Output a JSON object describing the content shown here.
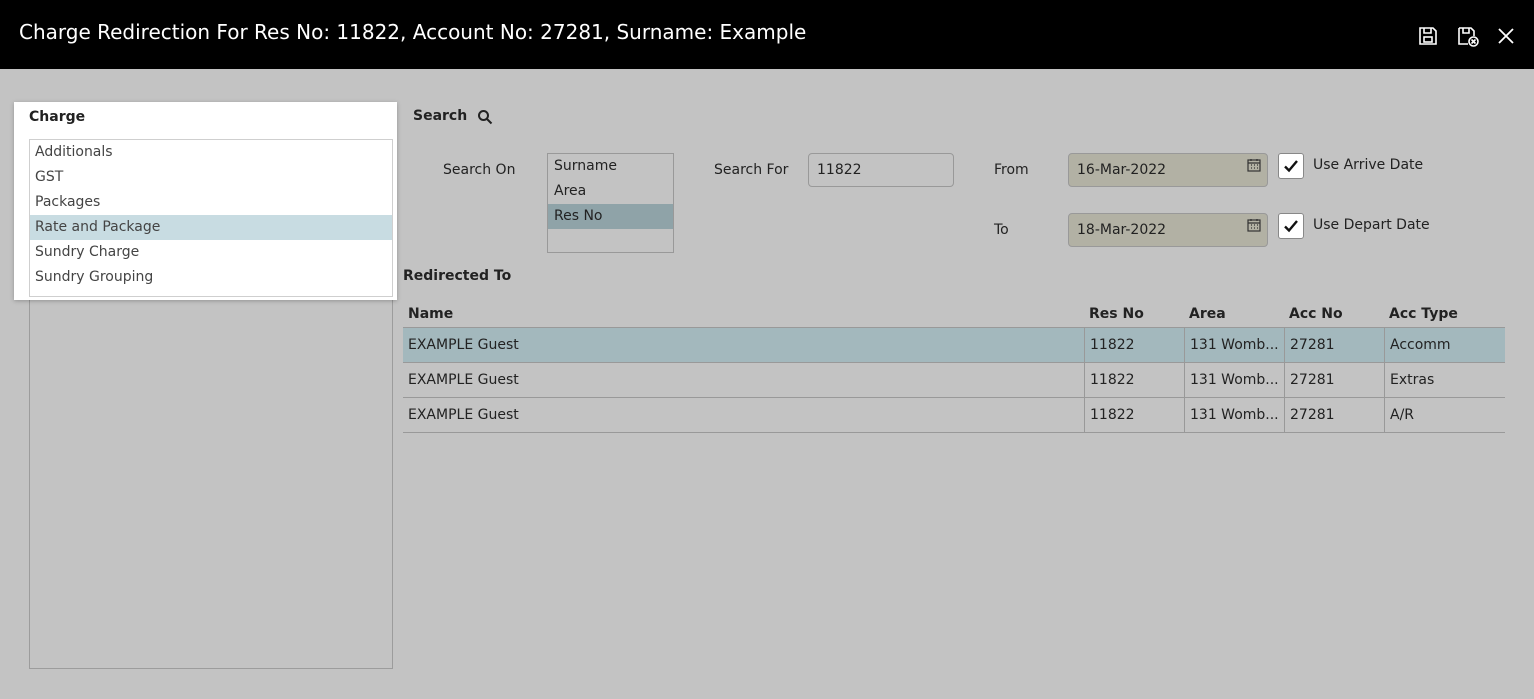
{
  "window": {
    "title": "Charge Redirection For Res No: 11822, Account No: 27281, Surname: Example",
    "buttons": [
      "save-icon",
      "save-and-close-icon",
      "close-icon"
    ]
  },
  "charge": {
    "header": "Charge",
    "items": [
      {
        "label": "Additionals",
        "selected": false
      },
      {
        "label": "GST",
        "selected": false
      },
      {
        "label": "Packages",
        "selected": false
      },
      {
        "label": "Rate and Package",
        "selected": true
      },
      {
        "label": "Sundry Charge",
        "selected": false
      },
      {
        "label": "Sundry Grouping",
        "selected": false
      }
    ]
  },
  "search": {
    "header": "Search",
    "search_on_label": "Search On",
    "search_on_options": [
      {
        "label": "Surname",
        "selected": false
      },
      {
        "label": "Area",
        "selected": false
      },
      {
        "label": "Res No",
        "selected": true
      }
    ],
    "search_for_label": "Search For",
    "search_for_value": "11822",
    "from_label": "From",
    "from_value": "16-Mar-2022",
    "to_label": "To",
    "to_value": "18-Mar-2022",
    "use_arrive_date_label": "Use Arrive Date",
    "use_arrive_date_checked": true,
    "use_depart_date_label": "Use Depart Date",
    "use_depart_date_checked": true
  },
  "redirected": {
    "header": "Redirected To",
    "columns": [
      "Name",
      "Res No",
      "Area",
      "Acc No",
      "Acc Type"
    ],
    "rows": [
      {
        "name": "EXAMPLE Guest",
        "res_no": "11822",
        "area": "131 Womb...",
        "acc_no": "27281",
        "acc_type": "Accomm",
        "selected": true
      },
      {
        "name": "EXAMPLE Guest",
        "res_no": "11822",
        "area": "131 Womb...",
        "acc_no": "27281",
        "acc_type": "Extras",
        "selected": false
      },
      {
        "name": "EXAMPLE Guest",
        "res_no": "11822",
        "area": "131 Womb...",
        "acc_no": "27281",
        "acc_type": "A/R",
        "selected": false
      }
    ]
  },
  "colors": {
    "titlebar": "#000000",
    "background": "#c3c3c3",
    "list_selected": "#c8dce2",
    "row_selected": "#a3b8bd",
    "date_field": "#b2b1a4"
  }
}
